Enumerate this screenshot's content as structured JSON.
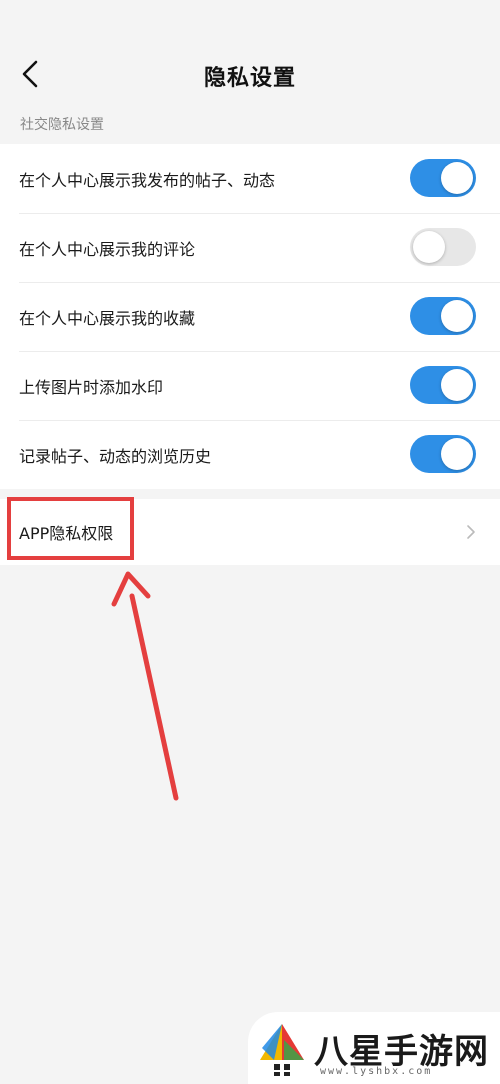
{
  "header": {
    "title": "隐私设置",
    "back_icon": "chevron-left-icon"
  },
  "section": {
    "label": "社交隐私设置"
  },
  "settings": [
    {
      "label": "在个人中心展示我发布的帖子、动态",
      "enabled": true
    },
    {
      "label": "在个人中心展示我的评论",
      "enabled": false
    },
    {
      "label": "在个人中心展示我的收藏",
      "enabled": true
    },
    {
      "label": "上传图片时添加水印",
      "enabled": true
    },
    {
      "label": "记录帖子、动态的浏览历史",
      "enabled": true
    }
  ],
  "app_privacy": {
    "label": "APP隐私权限",
    "icon": "chevron-right-icon"
  },
  "annotation": {
    "highlight_color": "#e43f3f"
  },
  "colors": {
    "toggle_on": "#2e8fe6",
    "toggle_off": "#e7e7e7",
    "background": "#f4f4f4"
  },
  "watermark": {
    "brand": "八星手游网",
    "url": "www.lyshbx.com"
  }
}
